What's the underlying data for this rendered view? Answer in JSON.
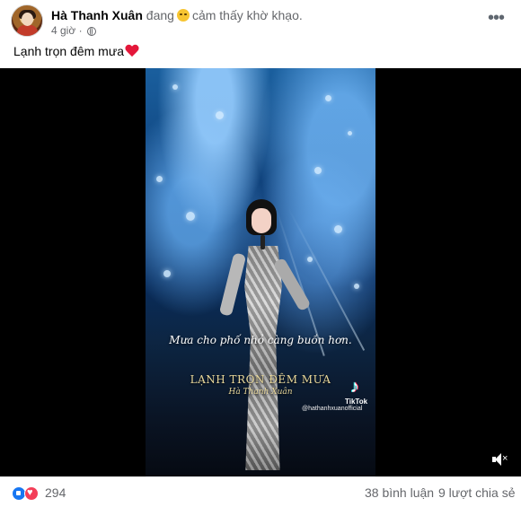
{
  "post": {
    "author": "Hà Thanh Xuân",
    "status_prefix": "đang",
    "feeling": "cảm thấy khờ khạo.",
    "time": "4 giờ",
    "caption": "Lạnh trọn đêm mưa"
  },
  "video": {
    "lyric": "Mưa cho phố nhỏ càng buồn hơn.",
    "song_title": "LẠNH TRỌN ĐÊM MƯA",
    "song_artist": "Hà Thanh Xuân",
    "tiktok_label": "TikTok",
    "tiktok_handle": "@hathanhxuanofficial"
  },
  "footer": {
    "reaction_count": "294",
    "comments": "38 bình luận",
    "shares": "9 lượt chia sẻ"
  },
  "icons": {
    "privacy": "globe-icon",
    "more": "more-dots-icon",
    "feeling": "emoji-icon",
    "caption_emoji": "red-heart-icon",
    "volume": "volume-muted-icon",
    "reactions": [
      "like-icon",
      "love-icon"
    ]
  },
  "colors": {
    "like": "#1877f2",
    "love": "#f33e58",
    "text_secondary": "#65676b"
  }
}
